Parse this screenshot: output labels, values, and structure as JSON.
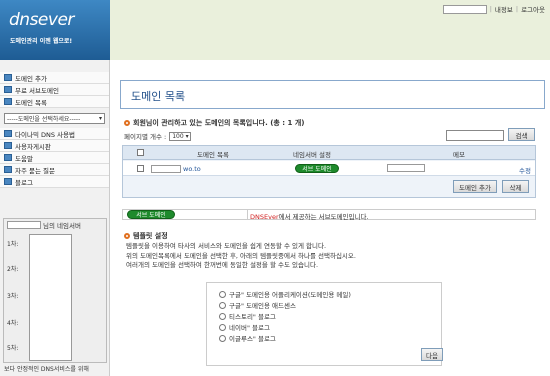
{
  "header": {
    "logo": "dnsever",
    "tagline": "도메인관리 이젠 웹으로!",
    "links": [
      "내정보",
      "로그아웃"
    ]
  },
  "sidebar": {
    "items_top": [
      "도메인 추가",
      "무료 서브도메인",
      "도메인 목록"
    ],
    "select_placeholder": "-----도메인을 선택하세요-----",
    "items_bottom": [
      "다이나믹 DNS 사용법",
      "사용자게시판",
      "도움말",
      "자주 묻는 질문",
      "블로그"
    ],
    "nameserver_title_suffix": "님의 네임서버",
    "nameserver_rows": [
      "1차:",
      "2차:",
      "3차:",
      "4차:",
      "5차:"
    ],
    "bottom_text": "보다 안정적인 DNS서비스를 위해"
  },
  "main": {
    "page_title": "도메인 목록",
    "section1_heading": "회원님이 관리하고 있는 도메인의 목록입니다. (총 : 1 개)",
    "per_page_label": "페이지별 개수 :",
    "per_page_value": "100",
    "search_button": "검색",
    "table": {
      "headers": [
        "도메인 목록",
        "네임서버 설정",
        "메모"
      ],
      "rows": [
        {
          "domain_suffix": "wo.to",
          "ns_status": "서브 도메인",
          "action": "수정"
        }
      ]
    },
    "add_domain_button": "도메인 추가",
    "delete_button": "삭제",
    "legend_badge": "서브 도메인",
    "legend_brand": "DNSEver",
    "legend_text": "에서 제공하는 서브도메인입니다.",
    "section2_heading": "템플릿 설정",
    "desc_lines": [
      "템플릿을 이용하여 타사의 서비스와 도메인을 쉽게 연동할 수 있게 합니다.",
      "위의 도메인목록에서 도메인을 선택한 후, 아래의 템플릿중에서 하나를 선택하십시오.",
      "여러개의 도메인을 선택하여 한꺼번에 동일한 설정을 할 수도 있습니다."
    ],
    "template_options": [
      "구글\" 도메인용 어플리케이션(도메인용 메일)",
      "구글\" 도메인용 애드센스",
      "티스토리\" 블로그",
      "네이버\" 블로그",
      "이글루스\" 블로그"
    ],
    "next_button": "다음"
  },
  "colors": {
    "brand_blue": "#2f74b3",
    "badge_green": "#1e8a2c",
    "header_bg": "#eaf0dc",
    "accent_orange": "#e07020"
  }
}
